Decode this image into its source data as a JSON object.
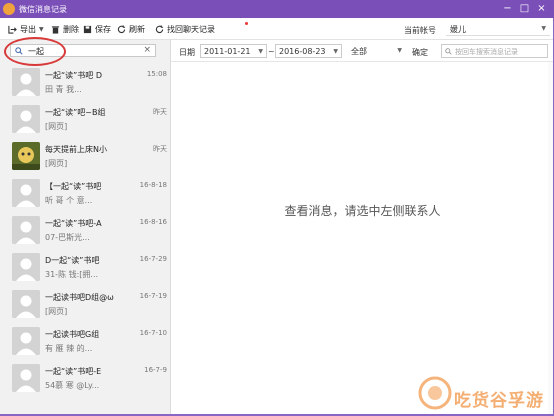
{
  "window": {
    "title": "微信消息记录"
  },
  "toolbar": {
    "export_label": "导出",
    "delete_label": "删除",
    "save_label": "保存",
    "refresh_label": "刷新",
    "retrieve_label": "找回聊天记录",
    "account_label": "当前帐号",
    "account_value": "媛儿"
  },
  "search": {
    "value": "一起"
  },
  "contacts": [
    {
      "name": "一起“读”书吧 D",
      "preview": "田 青 我...",
      "time": "15:08",
      "avatar": "default"
    },
    {
      "name": "一起“读”吧~B组",
      "preview": "[网页]",
      "time": "昨天",
      "avatar": "default"
    },
    {
      "name": "每天提前上床N小",
      "preview": "[网页]",
      "time": "昨天",
      "avatar": "photo"
    },
    {
      "name": "【一起“读”书吧",
      "preview": "听 哥 个 意...",
      "time": "16-8-18",
      "avatar": "default"
    },
    {
      "name": "一起“读”书吧-A",
      "preview": "07-巴斯光...",
      "time": "16-8-16",
      "avatar": "default"
    },
    {
      "name": "D一起“读”书吧",
      "preview": "31-陈 钱:[拥...",
      "time": "16-7-29",
      "avatar": "default"
    },
    {
      "name": "一起读书吧D组@ω",
      "preview": "[网页]",
      "time": "16-7-19",
      "avatar": "default"
    },
    {
      "name": "一起读书吧G组",
      "preview": "有 雁 辣 的...",
      "time": "16-7-10",
      "avatar": "default"
    },
    {
      "name": "一起“读”书吧-E",
      "preview": "54慕 寒 @Ly...",
      "time": "16-7-9",
      "avatar": "default"
    }
  ],
  "filter": {
    "date_label": "日期",
    "start_date": "2011-01-21",
    "separator": "~",
    "end_date": "2016-08-23",
    "type_value": "全部",
    "confirm_label": "确定",
    "keyword_placeholder": "按回车搜索消息记录"
  },
  "main": {
    "placeholder_message": "查看消息，请选中左侧联系人"
  },
  "watermark": {
    "text": "吃货谷孚游"
  },
  "colors": {
    "titlebar": "#7a4fb8",
    "sidebar": "#f1f1f1",
    "annotation": "#d83a3a"
  }
}
